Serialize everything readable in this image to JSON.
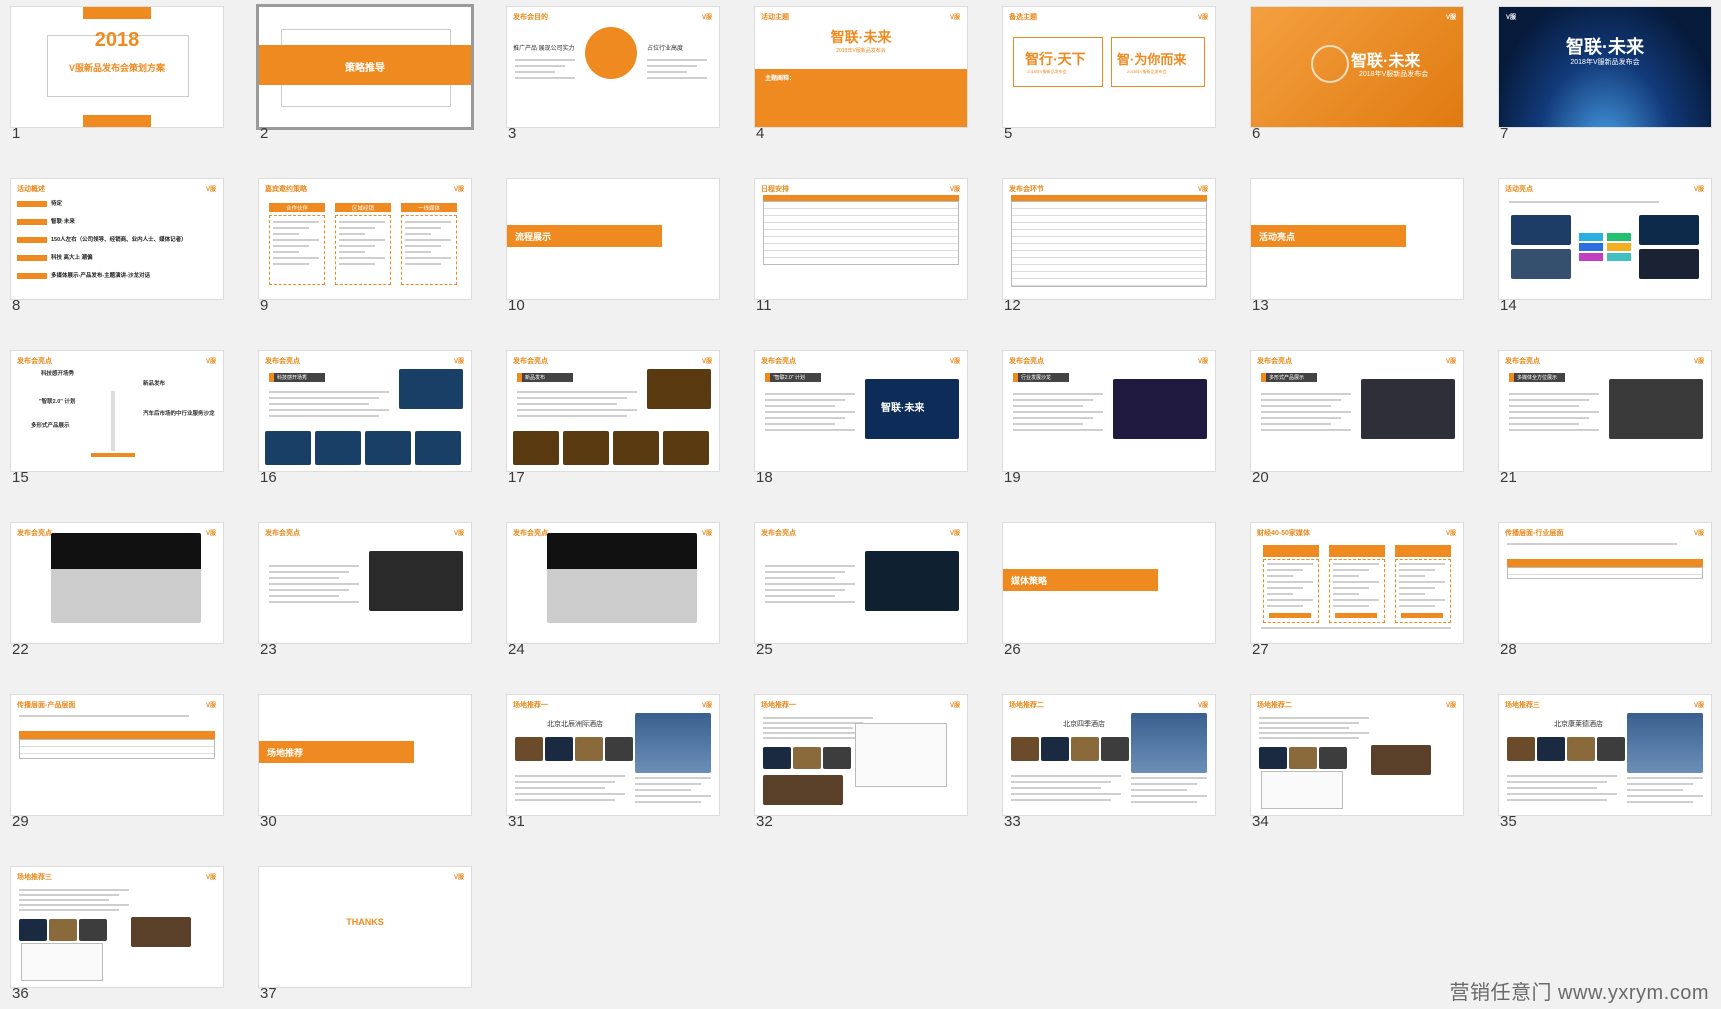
{
  "slides": [
    {
      "n": "1",
      "title": "2018",
      "subtitle": "V服新品发布会策划方案"
    },
    {
      "n": "2",
      "title": "策略推导"
    },
    {
      "n": "3",
      "header": "发布会目的",
      "left": "推广产品 展现公司实力",
      "right": "占位行业高度"
    },
    {
      "n": "4",
      "header": "活动主题",
      "title": "智联·未来",
      "sub": "2018年V服新品发布会",
      "label": "主题阐释："
    },
    {
      "n": "5",
      "header": "备选主题",
      "left": "智行·天下",
      "right": "智·为你而来",
      "sub": "2018年V服新品发布会"
    },
    {
      "n": "6",
      "title": "智联·未来",
      "sub": "2018年V服新品发布会"
    },
    {
      "n": "7",
      "title": "智联·未来",
      "sub": "2018年V服新品发布会"
    },
    {
      "n": "8",
      "header": "活动概述",
      "rows": [
        "待定",
        "智联·未来",
        "150人左右（公司领导、经销商、业内人士、媒体记者）",
        "科技 高大上 潮偏",
        "多媒体展示-产品发布-主题演讲-沙龙对话"
      ]
    },
    {
      "n": "9",
      "header": "嘉宾邀约策略",
      "cols": [
        "合作伙伴",
        "区域经销",
        "一线媒体"
      ]
    },
    {
      "n": "10",
      "title": "流程展示"
    },
    {
      "n": "11",
      "header": "日程安排"
    },
    {
      "n": "12",
      "header": "发布会环节"
    },
    {
      "n": "13",
      "title": "活动亮点"
    },
    {
      "n": "14",
      "header": "活动亮点"
    },
    {
      "n": "15",
      "header": "发布会亮点",
      "items": [
        "科技感开场秀",
        "新品发布",
        "\"智联2.0\" 计划",
        "汽车后市场的中行业服务沙龙",
        "多形式产品展示"
      ]
    },
    {
      "n": "16",
      "header": "发布会亮点",
      "tag": "科技感开场秀"
    },
    {
      "n": "17",
      "header": "发布会亮点",
      "tag": "新品发布"
    },
    {
      "n": "18",
      "header": "发布会亮点",
      "tag": "\"智联2.0\" 计划",
      "img": "智联·未来"
    },
    {
      "n": "19",
      "header": "发布会亮点",
      "tag": "行业发展沙龙"
    },
    {
      "n": "20",
      "header": "发布会亮点",
      "tag": "多形式产品展示"
    },
    {
      "n": "21",
      "header": "发布会亮点",
      "tag": "多媒体全方位展示"
    },
    {
      "n": "22",
      "header": "发布会亮点"
    },
    {
      "n": "23",
      "header": "发布会亮点"
    },
    {
      "n": "24",
      "header": "发布会亮点"
    },
    {
      "n": "25",
      "header": "发布会亮点"
    },
    {
      "n": "26",
      "title": "媒体策略"
    },
    {
      "n": "27",
      "header": "财经40-50家媒体"
    },
    {
      "n": "28",
      "header": "传播层面-行业层面"
    },
    {
      "n": "29",
      "header": "传播层面-产品层面"
    },
    {
      "n": "30",
      "title": "场地推荐"
    },
    {
      "n": "31",
      "header": "场地推荐一",
      "hotel": "北京北辰洲际酒店"
    },
    {
      "n": "32",
      "header": "场地推荐一"
    },
    {
      "n": "33",
      "header": "场地推荐二",
      "hotel": "北京四季酒店"
    },
    {
      "n": "34",
      "header": "场地推荐二"
    },
    {
      "n": "35",
      "header": "场地推荐三",
      "hotel": "北京康莱德酒店"
    },
    {
      "n": "36",
      "header": "场地推荐三"
    },
    {
      "n": "37",
      "title": "THANKS"
    }
  ],
  "watermark": "营销任意门 www.yxrym.com",
  "logo": "V服",
  "colors": {
    "accent": "#ee8a1f",
    "background": "#f1f1f1",
    "selected_border": "#9a9a9a"
  },
  "selected_slide": "2"
}
